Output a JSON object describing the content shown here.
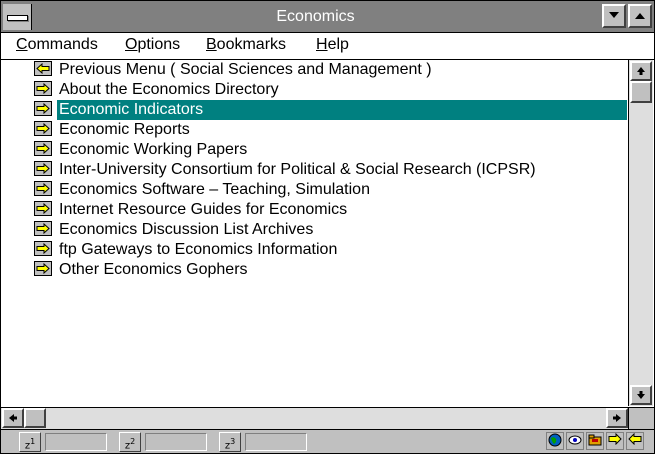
{
  "window": {
    "title": "Economics",
    "sys_menu_icon": "system-menu-icon",
    "min_icon": "minimize-icon",
    "max_icon": "maximize-icon"
  },
  "menubar": {
    "commands": {
      "accel": "C",
      "rest": "ommands"
    },
    "options": {
      "accel": "O",
      "rest": "ptions"
    },
    "bookmarks": {
      "accel": "B",
      "rest": "ookmarks"
    },
    "help": {
      "accel": "H",
      "rest": "elp"
    }
  },
  "items": [
    {
      "label": "Previous Menu ( Social Sciences and Management )",
      "icon": "back-arrow-icon",
      "selected": false
    },
    {
      "label": "About the Economics Directory",
      "icon": "forward-arrow-icon",
      "selected": false
    },
    {
      "label": "Economic Indicators",
      "icon": "forward-arrow-icon",
      "selected": true
    },
    {
      "label": "Economic Reports",
      "icon": "forward-arrow-icon",
      "selected": false
    },
    {
      "label": "Economic Working Papers",
      "icon": "forward-arrow-icon",
      "selected": false
    },
    {
      "label": "Inter-University Consortium for Political & Social Research (ICPSR)",
      "icon": "forward-arrow-icon",
      "selected": false
    },
    {
      "label": "Economics Software – Teaching, Simulation",
      "icon": "forward-arrow-icon",
      "selected": false
    },
    {
      "label": "Internet Resource Guides for Economics",
      "icon": "forward-arrow-icon",
      "selected": false
    },
    {
      "label": "Economics Discussion List Archives",
      "icon": "forward-arrow-icon",
      "selected": false
    },
    {
      "label": "ftp Gateways to Economics Information",
      "icon": "forward-arrow-icon",
      "selected": false
    },
    {
      "label": "Other Economics Gophers",
      "icon": "forward-arrow-icon",
      "selected": false
    }
  ],
  "statusbar": {
    "zoom_buttons": [
      {
        "label": "z",
        "sup": "1"
      },
      {
        "label": "z",
        "sup": "2"
      },
      {
        "label": "z",
        "sup": "3"
      }
    ],
    "tool_icons": [
      "globe-icon",
      "eye-icon",
      "folder-icon",
      "forward-icon",
      "back-icon"
    ]
  },
  "colors": {
    "selection": "#008080",
    "titlebar": "#808080",
    "arrow_fill": "#ffff00"
  }
}
